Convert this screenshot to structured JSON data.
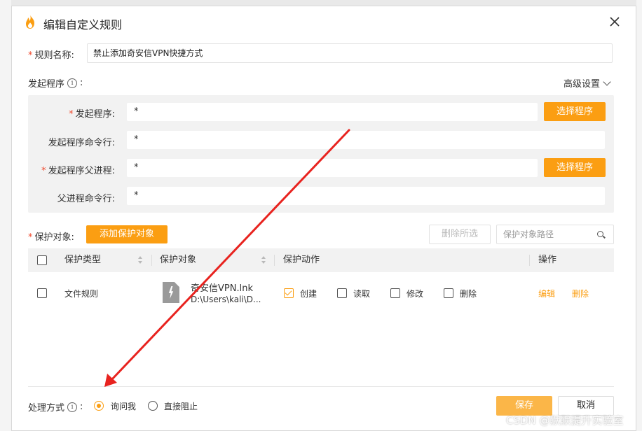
{
  "dialog": {
    "title": "编辑自定义规则",
    "close_icon": "close-icon"
  },
  "rule_name": {
    "label": "规则名称:",
    "value": "禁止添加奇安信VPN快捷方式"
  },
  "launcher": {
    "label": "发起程序",
    "colon": ":",
    "advanced_label": "高级设置",
    "rows": [
      {
        "label": "发起程序:",
        "required": true,
        "value": "*",
        "button": "选择程序"
      },
      {
        "label": "发起程序命令行:",
        "required": false,
        "value": "*"
      },
      {
        "label": "发起程序父进程:",
        "required": true,
        "value": "*",
        "button": "选择程序"
      },
      {
        "label": "父进程命令行:",
        "required": false,
        "value": "*"
      }
    ]
  },
  "protection": {
    "label": "保护对象:",
    "add_button": "添加保护对象",
    "delete_selected": "删除所选",
    "search_placeholder": "保护对象路径",
    "columns": {
      "type": "保护类型",
      "object": "保护对象",
      "action": "保护动作",
      "operation": "操作"
    },
    "rows": [
      {
        "type": "文件规则",
        "object_name": "奇安信VPN.lnk",
        "object_path": "D:\\Users\\kali\\D...",
        "actions": [
          {
            "label": "创建",
            "checked": true
          },
          {
            "label": "读取",
            "checked": false
          },
          {
            "label": "修改",
            "checked": false
          },
          {
            "label": "删除",
            "checked": false
          }
        ],
        "edit": "编辑",
        "delete": "删除"
      }
    ]
  },
  "handling": {
    "label": "处理方式",
    "colon": ":",
    "options": [
      {
        "label": "询问我",
        "selected": true
      },
      {
        "label": "直接阻止",
        "selected": false
      }
    ]
  },
  "footer": {
    "save": "保存",
    "cancel": "取消"
  },
  "watermark": "CSDN @默默提升实验室",
  "colors": {
    "accent": "#fb9e12",
    "required": "#f04b2f",
    "annotation_arrow": "#e8231f"
  }
}
